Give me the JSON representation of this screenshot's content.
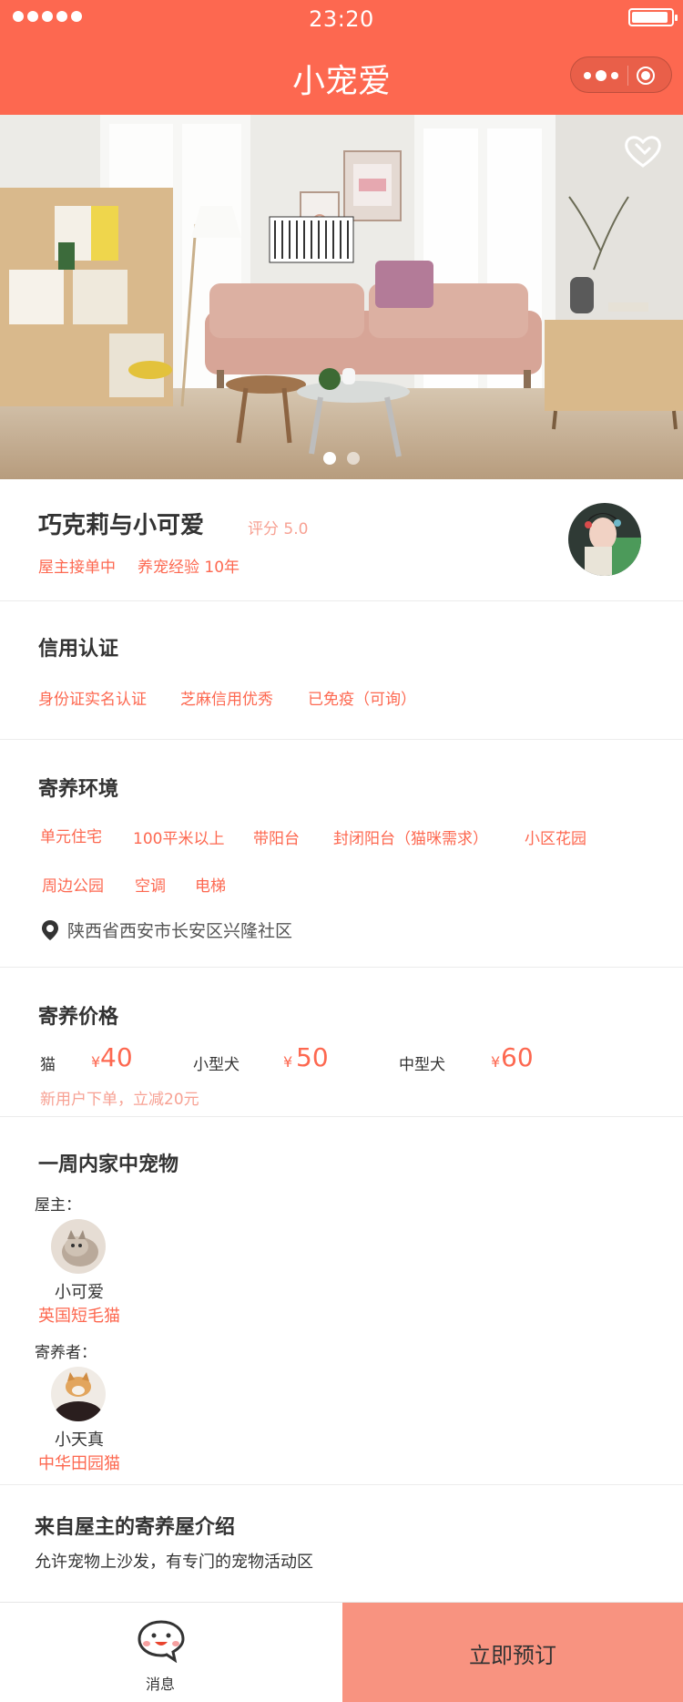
{
  "status_bar": {
    "time": "23:20",
    "battery_level": 0.92
  },
  "nav": {
    "title": "小宠爱"
  },
  "banner": {
    "slide_count": 2,
    "active_slide": 1,
    "favorite_icon": "heart-icon"
  },
  "host": {
    "name": "巧克莉与小可爱",
    "score": "评分 5.0",
    "tags": [
      "屋主接单中",
      "养宠经验 10年"
    ]
  },
  "credit": {
    "title": "信用认证",
    "tags": [
      "身份证实名认证",
      "芝麻信用优秀",
      "已免疫（可询）"
    ]
  },
  "environment": {
    "title": "寄养环境",
    "tags_row1": [
      "单元住宅",
      "100平米以上",
      "带阳台",
      "封闭阳台（猫咪需求）",
      "小区花园"
    ],
    "tags_row2": [
      "周边公园",
      "空调",
      "电梯"
    ],
    "address": "陕西省西安市长安区兴隆社区"
  },
  "pricing": {
    "title": "寄养价格",
    "currency": "¥",
    "items": [
      {
        "label": "猫",
        "price": "40"
      },
      {
        "label": "小型犬",
        "price": "50"
      },
      {
        "label": "中型犬",
        "price": "60"
      }
    ],
    "note": "新用户下单，立减20元"
  },
  "pets": {
    "title": "一周内家中宠物",
    "owner_label": "屋主：",
    "owner_pet": {
      "name": "小可爱",
      "breed": "英国短毛猫"
    },
    "boarder_label": "寄养者：",
    "boarder_pet": {
      "name": "小天真",
      "breed": "中华田园猫"
    }
  },
  "intro": {
    "title": "来自屋主的寄养屋介绍",
    "text": "允许宠物上沙发，有专门的宠物活动区"
  },
  "bottom": {
    "message_label": "消息",
    "book_label": "立即预订"
  },
  "colors": {
    "accent": "#fd6850",
    "soft_accent": "#f89380",
    "light_text": "#f7a193"
  }
}
